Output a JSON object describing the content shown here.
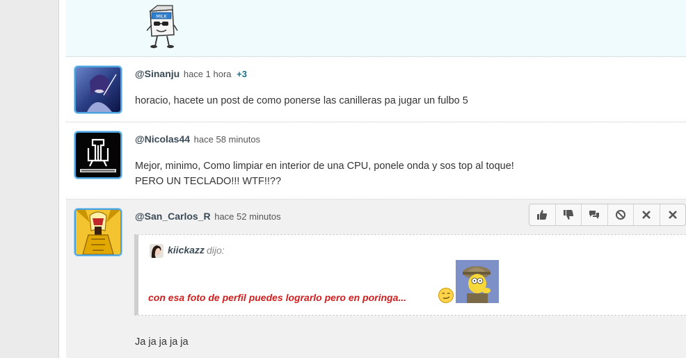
{
  "comments": [
    {
      "username": "@Sinanju",
      "time": "hace 1 hora",
      "score": "+3",
      "lines": [
        "horacio, hacete un post de como ponerse las canilleras pa jugar un fulbo 5"
      ]
    },
    {
      "username": "@Nicolas44",
      "time": "hace 58 minutos",
      "lines": [
        "Mejor, minimo, Como limpiar en interior de una CPU, ponele onda y sos top al toque!",
        "PERO UN TECLADO!!! WTF!!??"
      ]
    },
    {
      "username": "@San_Carlos_R",
      "time": "hace 52 minutos",
      "quote": {
        "author": "kiickazz",
        "said": "dijo:",
        "text": "con esa foto de perfil puedes lograrlo pero en poringa..."
      },
      "reply": "Ja ja ja ja ja",
      "actions": [
        "thumbs-up",
        "thumbs-down",
        "reply",
        "block",
        "delete",
        "close"
      ]
    }
  ],
  "sticker_text": "MILK",
  "colors": {
    "accent": "#1b6f8c",
    "quote_red": "#d01e1e",
    "avatar_border": "#4aa3df",
    "highlight_bg": "#f0fbfd"
  }
}
